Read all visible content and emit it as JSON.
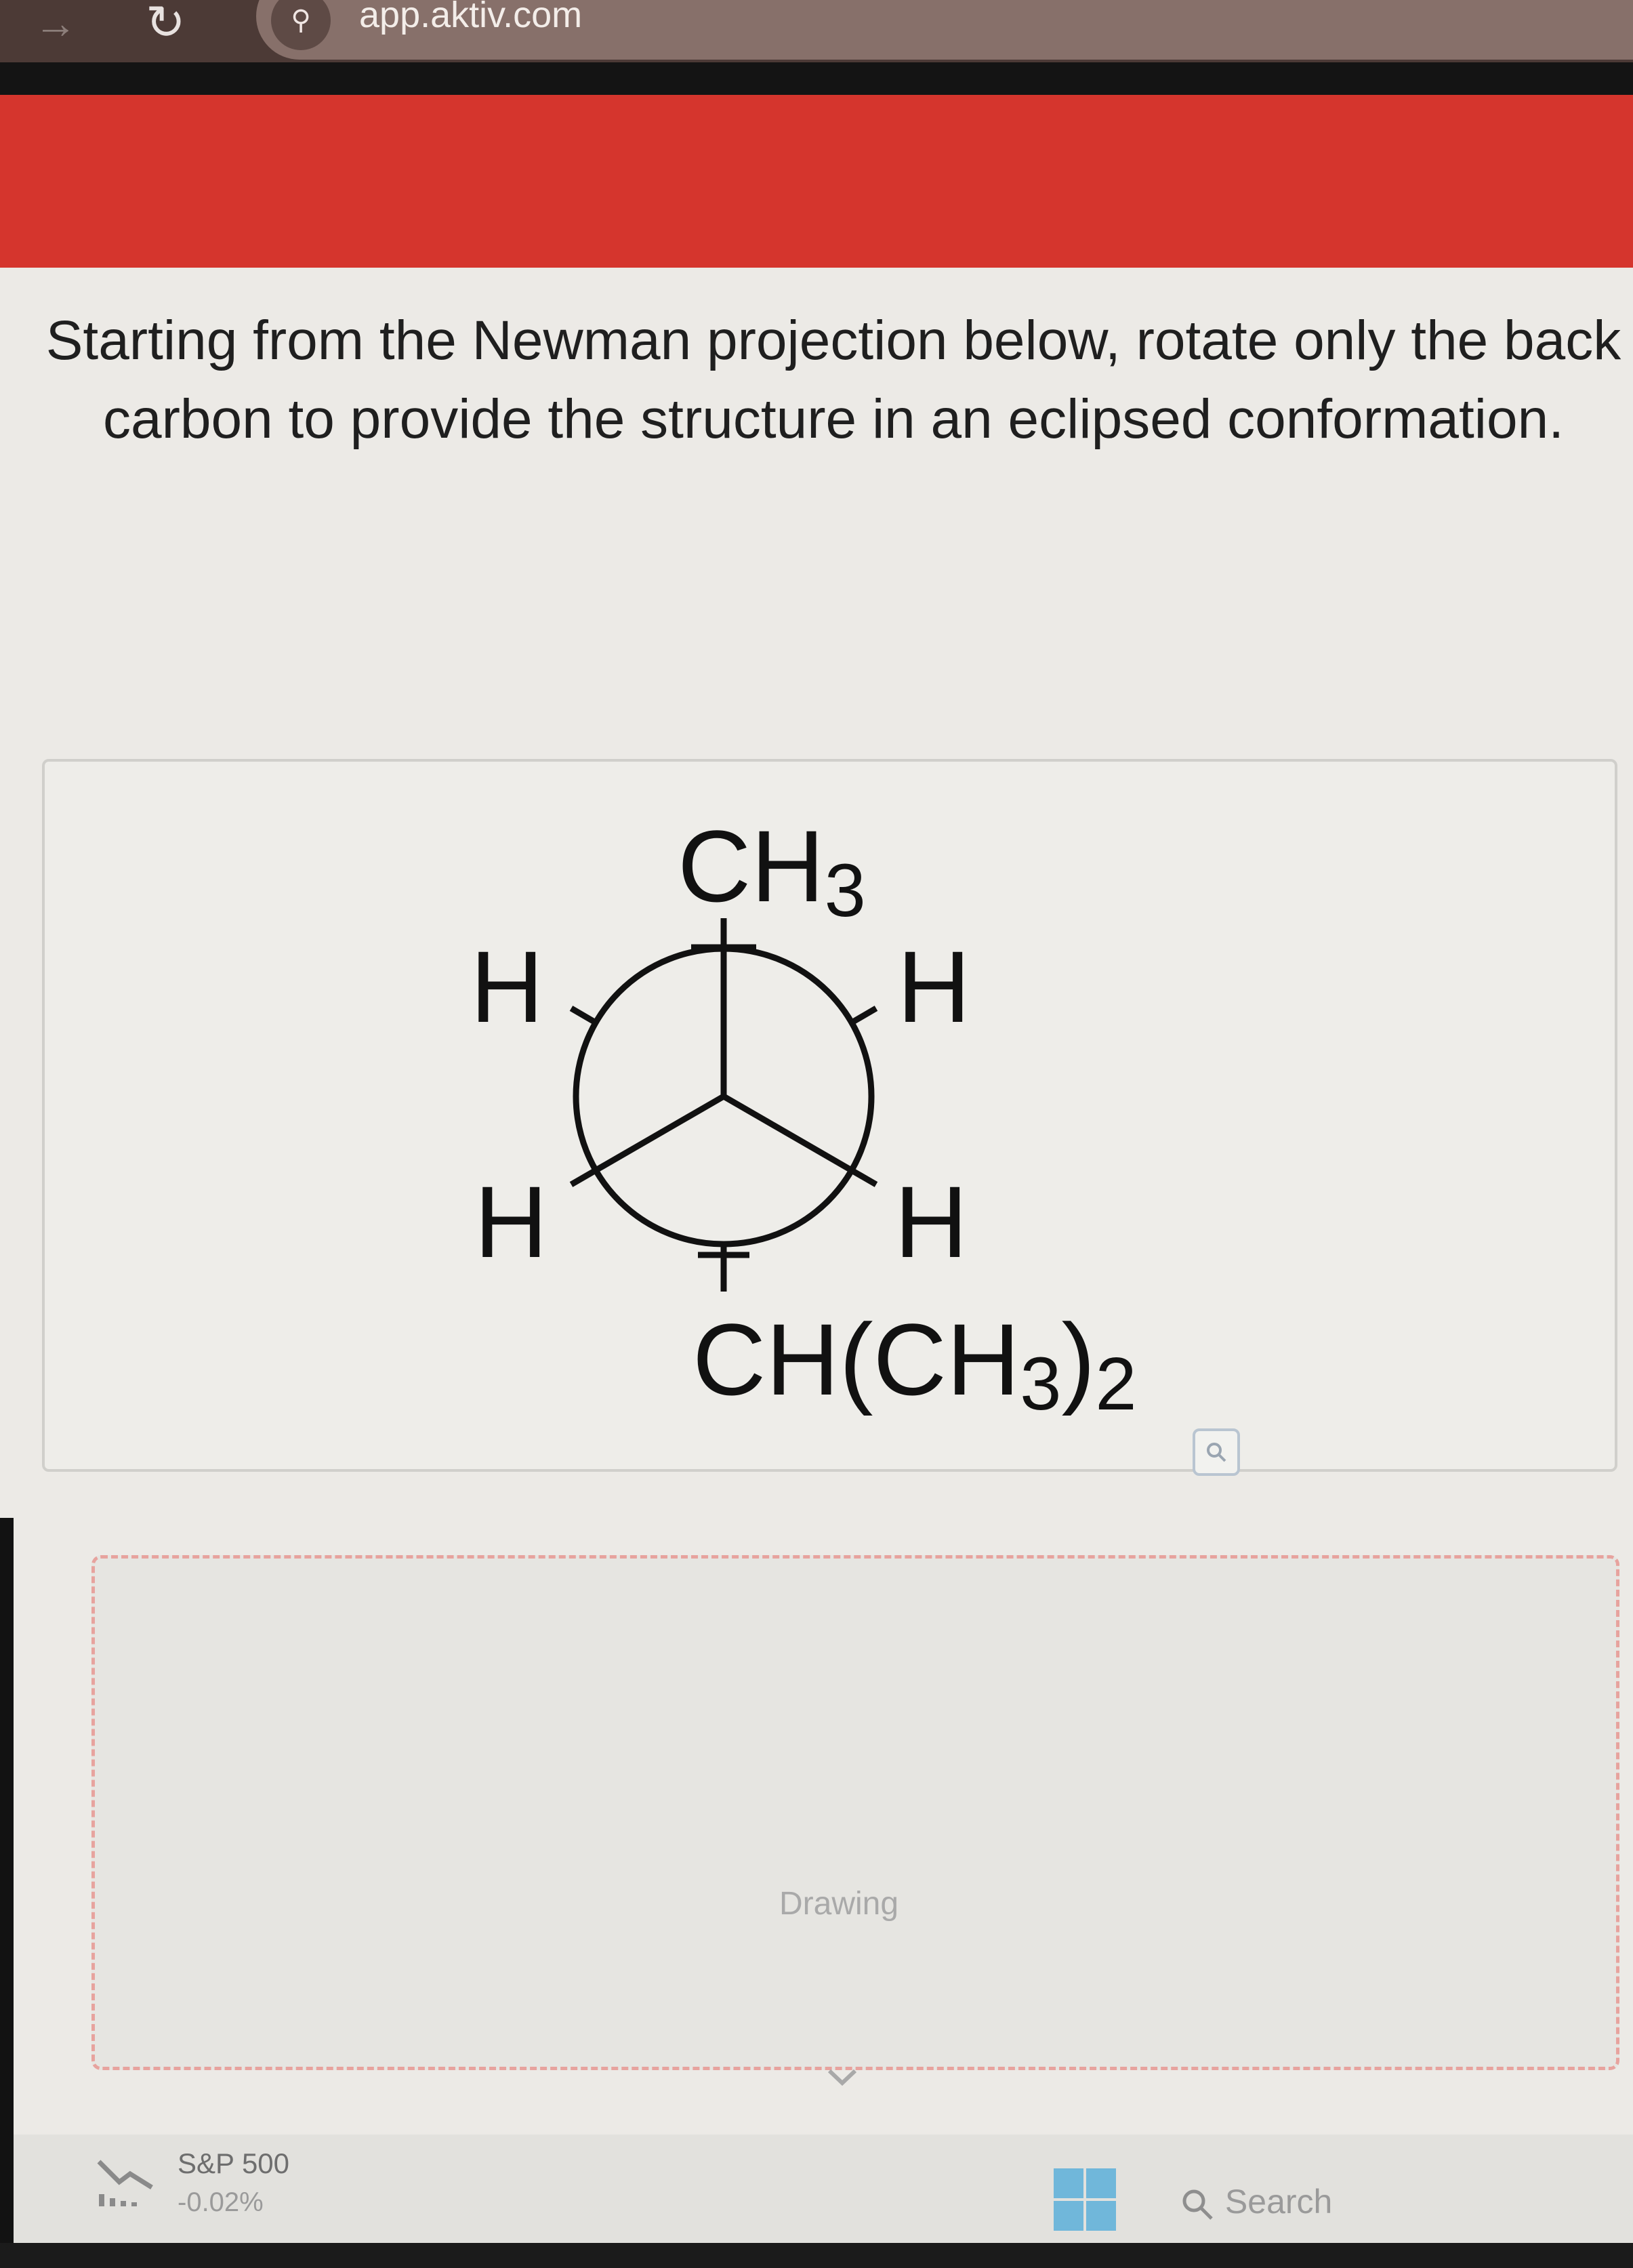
{
  "browser": {
    "url": "app.aktiv.com",
    "forward_icon": "→",
    "reload_icon": "↻",
    "site_icon": "⚲"
  },
  "question": {
    "text": "Starting from the Newman projection below, rotate only the back carbon to provide the structure in an eclipsed conformation."
  },
  "newman": {
    "front_top": "CH",
    "front_top_sub": "3",
    "back_upper_left": "H",
    "back_upper_right": "H",
    "front_lower_left": "H",
    "front_lower_right": "H",
    "back_bottom": "CH(CH",
    "back_bottom_sub": "3",
    "back_bottom_close": ")",
    "back_bottom_sub2": "2"
  },
  "drawing": {
    "label": "Drawing"
  },
  "taskbar": {
    "stock_name": "S&P 500",
    "stock_change": "-0.02%",
    "search_label": "Search"
  },
  "colors": {
    "header_red": "#d5352d",
    "drawing_border": "#e7a39e"
  }
}
